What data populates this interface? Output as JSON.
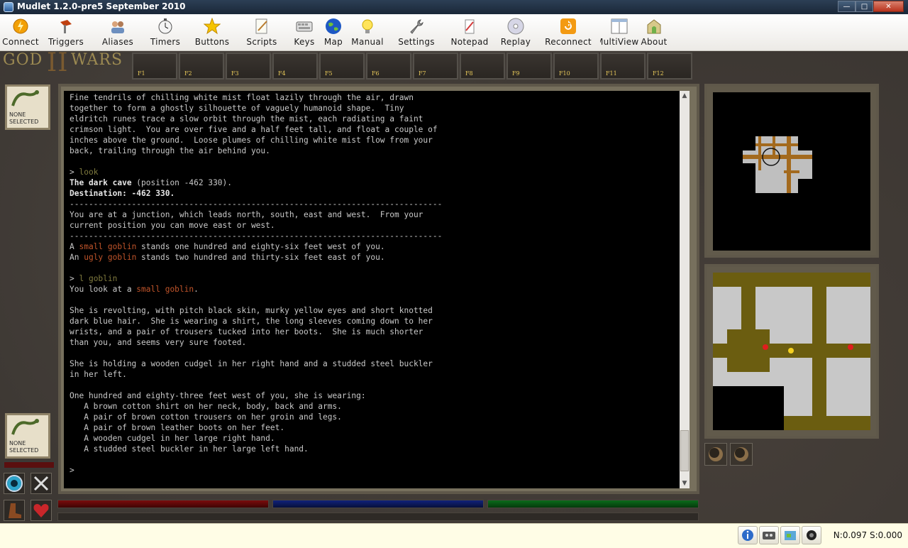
{
  "window": {
    "title": "Mudlet 1.2.0-pre5 September 2010"
  },
  "toolbar": {
    "items": [
      {
        "label": "Connect"
      },
      {
        "label": "Triggers"
      },
      {
        "label": "Aliases"
      },
      {
        "label": "Timers"
      },
      {
        "label": "Buttons"
      },
      {
        "label": "Scripts"
      },
      {
        "label": "Keys"
      },
      {
        "label": "Map"
      },
      {
        "label": "Manual"
      },
      {
        "label": "Settings"
      },
      {
        "label": "Notepad"
      },
      {
        "label": "Replay"
      },
      {
        "label": "Reconnect"
      },
      {
        "label": "MultiView"
      },
      {
        "label": "About"
      }
    ]
  },
  "game": {
    "logo": {
      "left": "GOD",
      "numeral": "II",
      "right": "WARS"
    },
    "fkeys": [
      "F1",
      "F2",
      "F3",
      "F4",
      "F5",
      "F6",
      "F7",
      "F8",
      "F9",
      "F10",
      "F11",
      "F12"
    ],
    "target_top": {
      "line1": "NONE",
      "line2": "SELECTED"
    },
    "target_bottom": {
      "line1": "NONE",
      "line2": "SELECTED"
    }
  },
  "console": {
    "intro": "Fine tendrils of chilling white mist float lazily through the air, drawn\ntogether to form a ghostly silhouette of vaguely humanoid shape.  Tiny\neldritch runes trace a slow orbit through the mist, each radiating a faint\ncrimson light.  You are over five and a half feet tall, and float a couple of\ninches above the ground.  Loose plumes of chilling white mist flow from your\nback, trailing through the air behind you.",
    "prompt1": "> ",
    "cmd1": "look",
    "room_name": "The dark cave",
    "room_pos": " (position -462 330).",
    "destination": "Destination: -462 330.",
    "separator": "------------------------------------------------------------------------------",
    "junction": "You are at a junction, which leads north, south, east and west.  From your\ncurrent position you can move east or west.",
    "mob1_pre": "A ",
    "mob1_name": "small goblin",
    "mob1_post": " stands one hundred and eighty-six feet west of you.",
    "mob2_pre": "An ",
    "mob2_name": "ugly goblin",
    "mob2_post": " stands two hundred and thirty-six feet east of you.",
    "prompt2": "> ",
    "cmd2": "l goblin",
    "look_pre": "You look at a ",
    "look_name": "small goblin",
    "look_post": ".",
    "desc": "She is revolting, with pitch black skin, murky yellow eyes and short knotted\ndark blue hair.  She is wearing a shirt, the long sleeves coming down to her\nwrists, and a pair of trousers tucked into her boots.  She is much shorter\nthan you, and seems very sure footed.",
    "holding": "She is holding a wooden cudgel in her right hand and a studded steel buckler\nin her left.",
    "wearing": "One hundred and eighty-three feet west of you, she is wearing:\n   A brown cotton shirt on her neck, body, back and arms.\n   A pair of brown cotton trousers on her groin and legs.\n   A pair of brown leather boots on her feet.\n   A wooden cudgel in her large right hand.\n   A studded steel buckler in her large left hand.",
    "prompt_final": ">"
  },
  "status": {
    "text": "N:0.097 S:0.000"
  },
  "colors": {
    "command": "#7f7a3e",
    "mob": "#c0542a",
    "path": "#6b5d10",
    "floor": "#c8c8c8"
  }
}
